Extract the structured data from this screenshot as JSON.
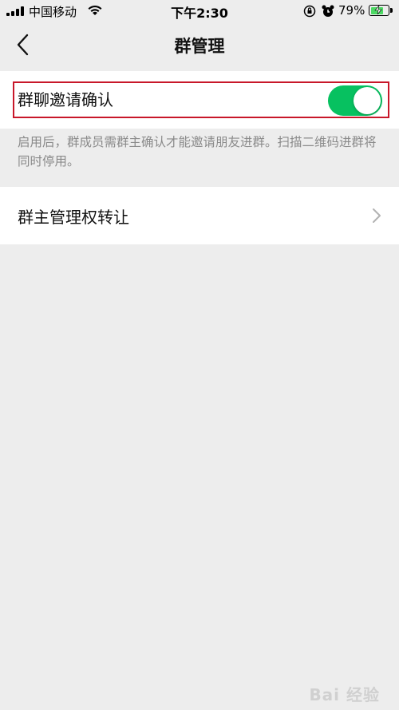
{
  "status_bar": {
    "carrier": "中国移动",
    "time": "下午2:30",
    "battery_percent": "79%",
    "battery_level": 0.79,
    "icons": [
      "signal-icon",
      "wifi-icon",
      "orientation-lock-icon",
      "alarm-icon",
      "battery-charging-icon"
    ]
  },
  "nav": {
    "title": "群管理",
    "back_icon": "chevron-left-icon"
  },
  "settings": {
    "invite_confirm": {
      "label": "群聊邀请确认",
      "enabled": true
    },
    "description": "启用后，群成员需群主确认才能邀请朋友进群。扫描二维码进群将同时停用。",
    "transfer": {
      "label": "群主管理权转让",
      "icon": "chevron-right-icon"
    }
  },
  "watermark": "Bai 经验",
  "colors": {
    "toggle_on": "#07c160",
    "highlight": "#c8172a",
    "background": "#ededed"
  }
}
